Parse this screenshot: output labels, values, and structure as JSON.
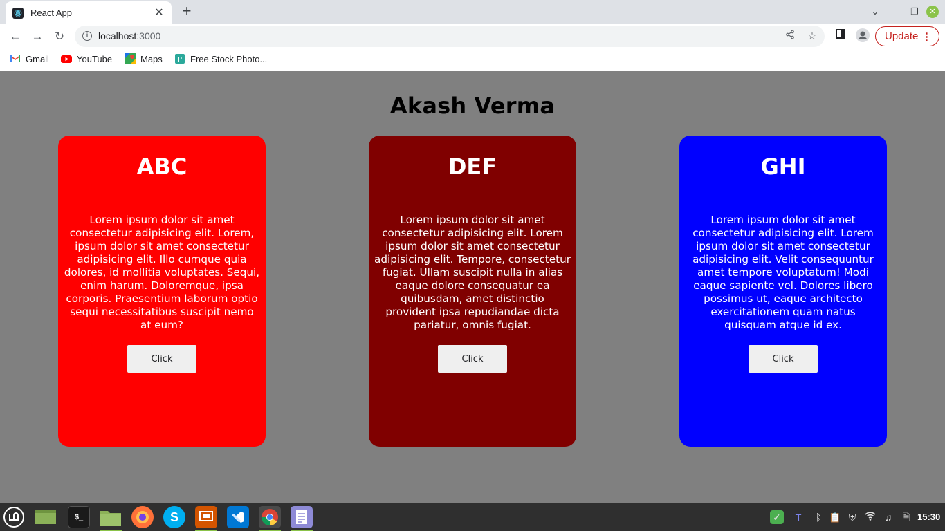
{
  "browser": {
    "tab_title": "React App",
    "tab_close": "✕",
    "new_tab": "+",
    "url_host": "localhost",
    "url_port": ":3000",
    "update_label": "Update",
    "menu_glyph": "⋮"
  },
  "bookmarks": [
    {
      "label": "Gmail",
      "icon": "gmail-icon",
      "color": "#ea4335"
    },
    {
      "label": "YouTube",
      "icon": "youtube-icon",
      "color": "#ff0000"
    },
    {
      "label": "Maps",
      "icon": "maps-icon",
      "color": "#34a853"
    },
    {
      "label": "Free Stock Photo...",
      "icon": "stock-photo-icon",
      "color": "#2ba99b"
    }
  ],
  "page": {
    "title": "Akash Verma",
    "cards": [
      {
        "title": "ABC",
        "text": "Lorem ipsum dolor sit amet consectetur adipisicing elit. Lorem, ipsum dolor sit amet consectetur adipisicing elit. Illo cumque quia dolores, id mollitia voluptates. Sequi, enim harum. Doloremque, ipsa corporis. Praesentium laborum optio sequi necessitatibus suscipit nemo at eum?",
        "button": "Click",
        "color": "#ff0000"
      },
      {
        "title": "DEF",
        "text": "Lorem ipsum dolor sit amet consectetur adipisicing elit. Lorem ipsum dolor sit amet consectetur adipisicing elit. Tempore, consectetur fugiat. Ullam suscipit nulla in alias eaque dolore consequatur ea quibusdam, amet distinctio provident ipsa repudiandae dicta pariatur, omnis fugiat.",
        "button": "Click",
        "color": "#800000"
      },
      {
        "title": "GHI",
        "text": "Lorem ipsum dolor sit amet consectetur adipisicing elit. Lorem ipsum dolor sit amet consectetur adipisicing elit. Velit consequuntur amet tempore voluptatum! Modi eaque sapiente vel. Dolores libero possimus ut, eaque architecto exercitationem quam natus quisquam atque id ex.",
        "button": "Click",
        "color": "#0000ff"
      }
    ]
  },
  "taskbar": {
    "clock": "15:30",
    "apps": [
      "mint-menu-icon",
      "desktop-icon",
      "terminal-icon",
      "files-icon",
      "firefox-icon",
      "skype-icon",
      "slides-icon",
      "vscode-icon",
      "chrome-icon",
      "text-editor-icon"
    ]
  }
}
